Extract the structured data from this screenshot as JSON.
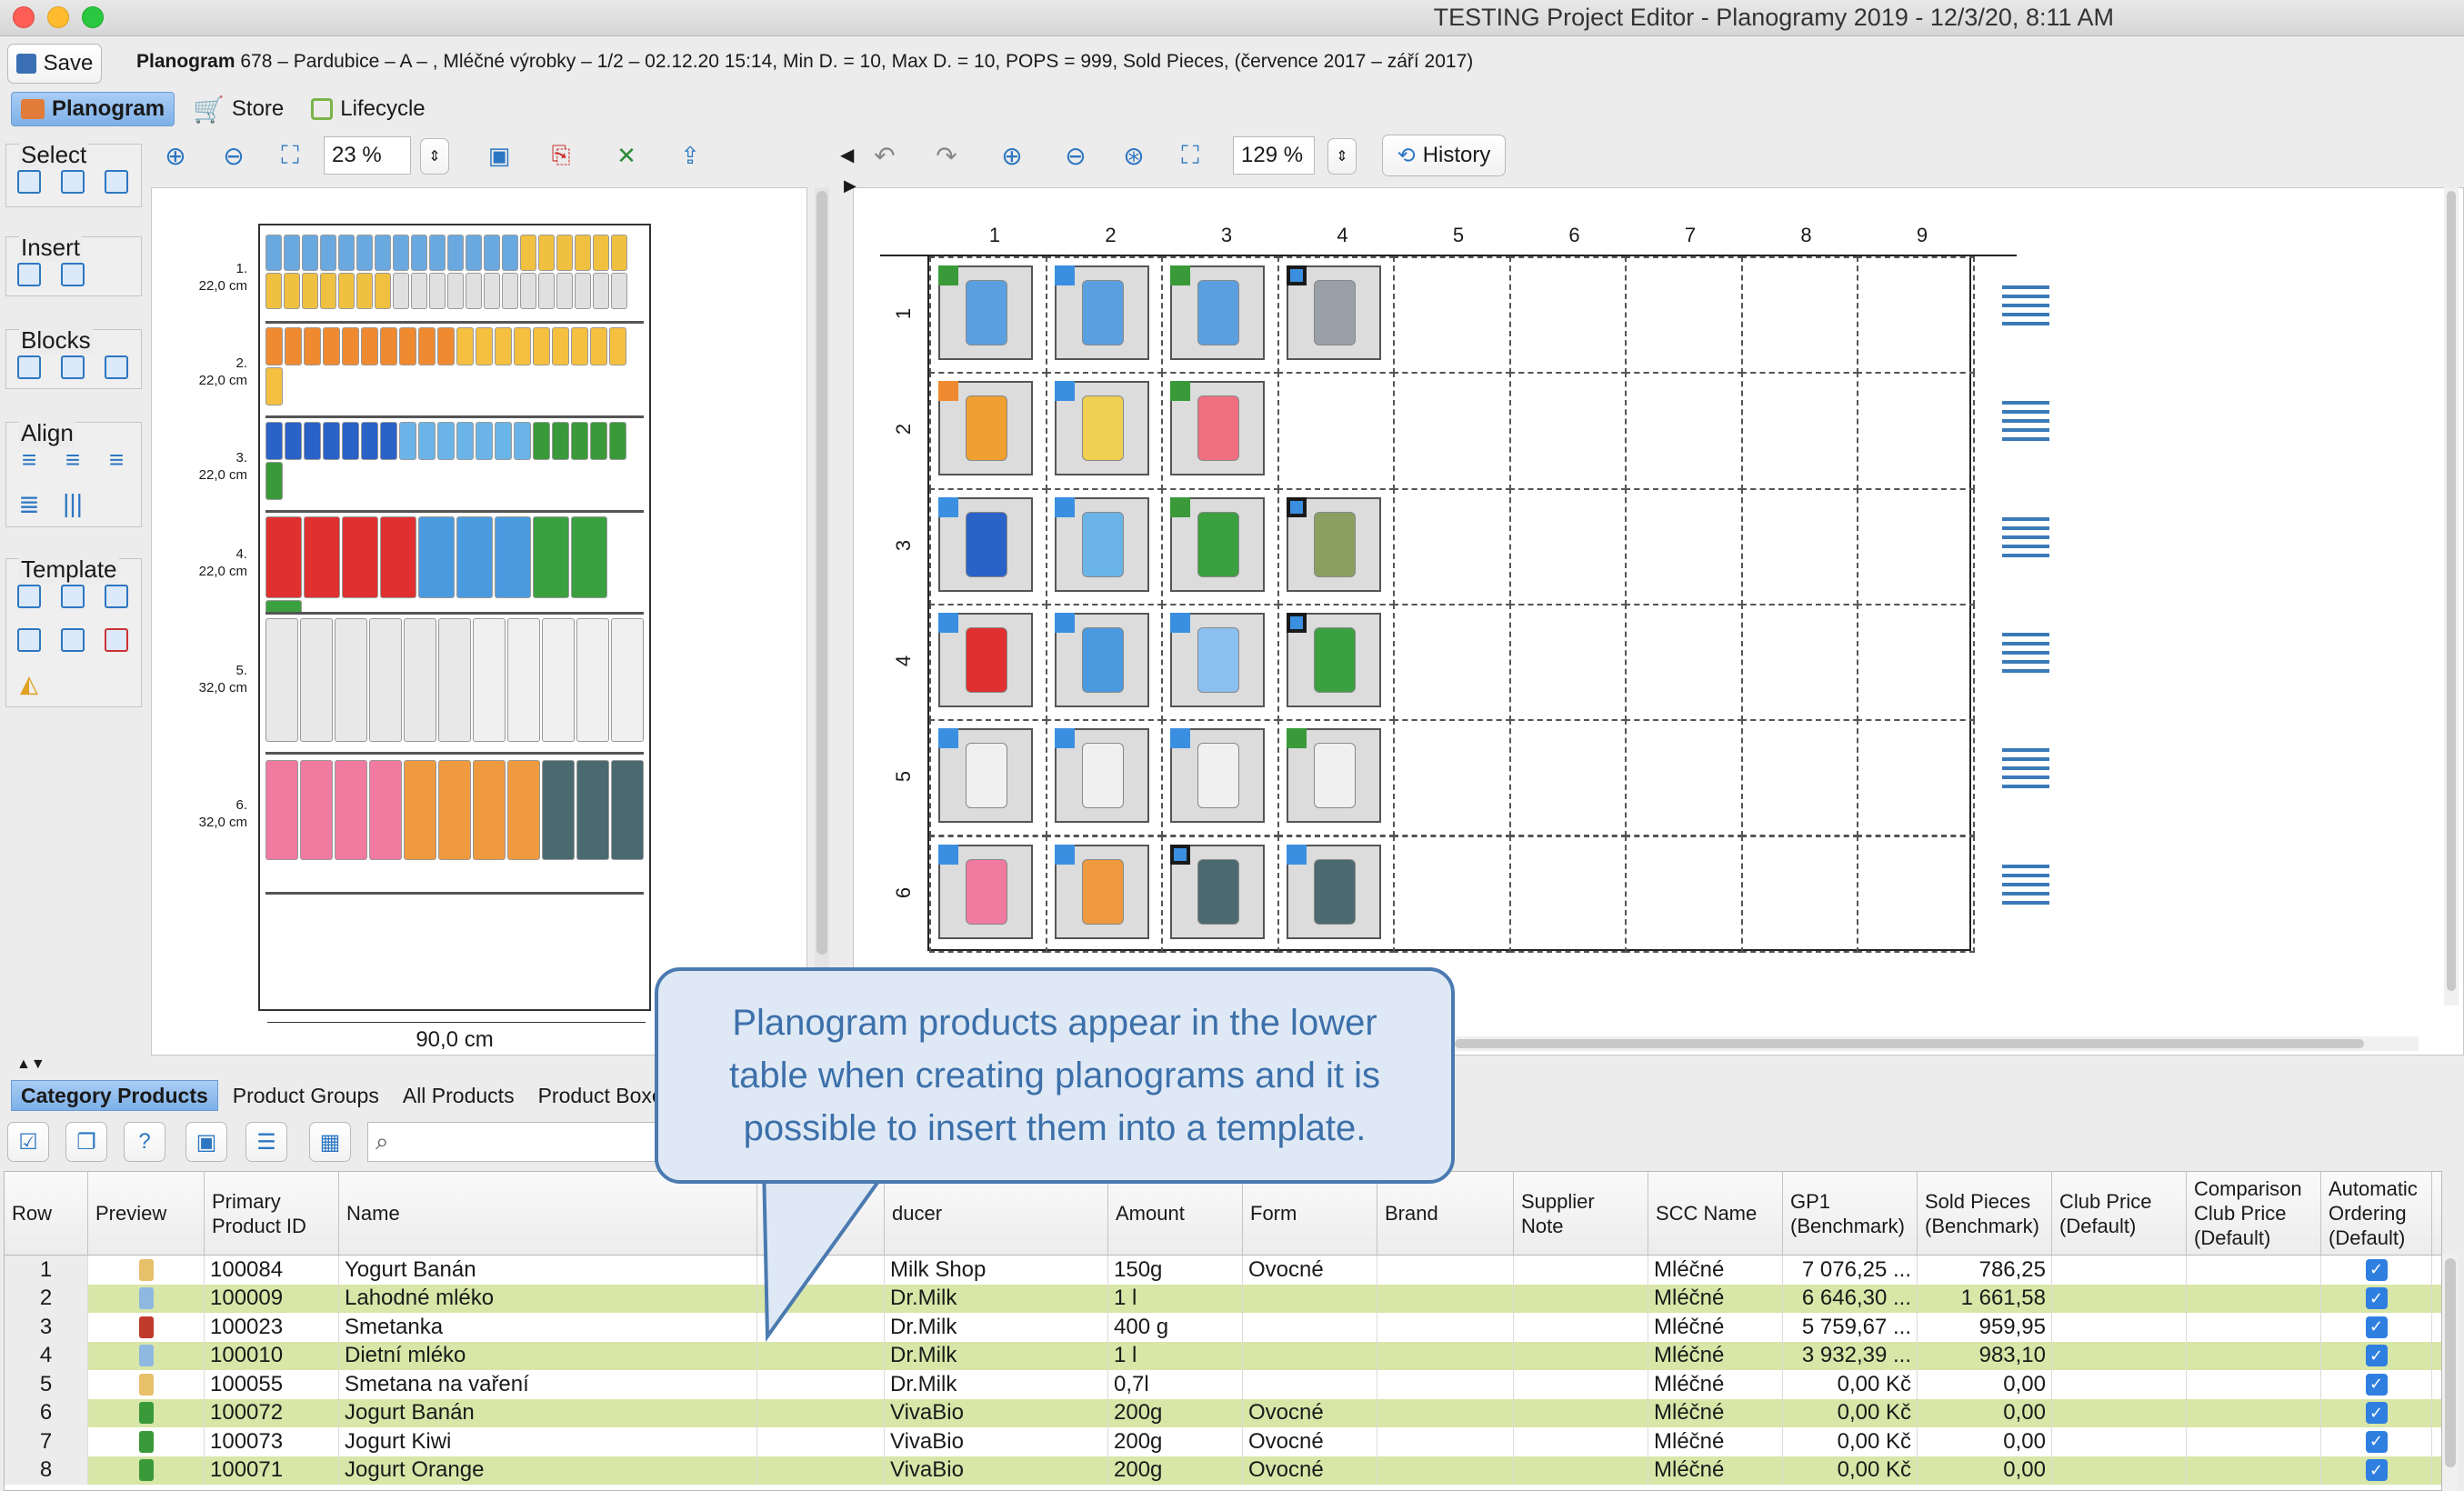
{
  "window": {
    "title": "TESTING Project Editor - Planogramy 2019 - 12/3/20, 8:11 AM"
  },
  "toolbar": {
    "save_label": "Save"
  },
  "planogram_info": {
    "label": "Planogram",
    "details": "678 – Pardubice – A – , Mléčné výrobky – 1/2 – 02.12.20 15:14, Min D. = 10, Max D. = 10, POPS = 999, Sold Pieces, (července 2017 – září 2017)"
  },
  "top_tabs": [
    {
      "label": "Planogram"
    },
    {
      "label": "Store"
    },
    {
      "label": "Lifecycle"
    }
  ],
  "left_groups": {
    "select": "Select",
    "insert": "Insert",
    "blocks": "Blocks",
    "align": "Align",
    "template": "Template"
  },
  "left_zoom": "23 %",
  "right_zoom": "129 %",
  "history_label": "History",
  "shelf_labels": [
    {
      "n": "1.",
      "h": "22,0 cm"
    },
    {
      "n": "2.",
      "h": "22,0 cm"
    },
    {
      "n": "3.",
      "h": "22,0 cm"
    },
    {
      "n": "4.",
      "h": "22,0 cm"
    },
    {
      "n": "5.",
      "h": "32,0 cm"
    },
    {
      "n": "6.",
      "h": "32,0 cm"
    }
  ],
  "shelf_width": "90,0 cm",
  "grid": {
    "cols": [
      "1",
      "2",
      "3",
      "4",
      "5",
      "6",
      "7",
      "8",
      "9"
    ],
    "rows": [
      "1",
      "2",
      "3",
      "4",
      "5",
      "6"
    ]
  },
  "bottom_tabs": [
    {
      "label": "Category Products"
    },
    {
      "label": "Product Groups"
    },
    {
      "label": "All Products"
    },
    {
      "label": "Product Boxe"
    }
  ],
  "search": {
    "placeholder": ""
  },
  "callout": {
    "text": "Planogram products appear in the lower table when creating planograms and it is possible to insert them into a template."
  },
  "table": {
    "headers": [
      "Row",
      "Preview",
      "Primary Product ID",
      "Name",
      "L",
      "ducer",
      "Amount",
      "Form",
      "Brand",
      "Supplier Note",
      "SCC Name",
      "GP1 (Benchmark)",
      "Sold Pieces (Benchmark)",
      "Club Price (Default)",
      "Comparison Club Price (Default)",
      "Automatic Ordering (Default)"
    ],
    "rows": [
      {
        "row": "1",
        "id": "100084",
        "name": "Yogurt Banán",
        "producer": "Milk Shop",
        "amount": "150g",
        "form": "Ovocné",
        "scc": "Mléčné",
        "gp1": "7 076,25 ...",
        "sold": "786,25"
      },
      {
        "row": "2",
        "id": "100009",
        "name": "Lahodné mléko",
        "producer": "Dr.Milk",
        "amount": "1 l",
        "form": "",
        "scc": "Mléčné",
        "gp1": "6 646,30 ...",
        "sold": "1 661,58"
      },
      {
        "row": "3",
        "id": "100023",
        "name": "Smetanka",
        "producer": "Dr.Milk",
        "amount": "400 g",
        "form": "",
        "scc": "Mléčné",
        "gp1": "5 759,67 ...",
        "sold": "959,95"
      },
      {
        "row": "4",
        "id": "100010",
        "name": "Dietní mléko",
        "producer": "Dr.Milk",
        "amount": "1 l",
        "form": "",
        "scc": "Mléčné",
        "gp1": "3 932,39 ...",
        "sold": "983,10"
      },
      {
        "row": "5",
        "id": "100055",
        "name": "Smetana na vaření",
        "producer": "Dr.Milk",
        "amount": "0,7l",
        "form": "",
        "scc": "Mléčné",
        "gp1": "0,00 Kč",
        "sold": "0,00"
      },
      {
        "row": "6",
        "id": "100072",
        "name": "Jogurt Banán",
        "producer": "VivaBio",
        "amount": "200g",
        "form": "Ovocné",
        "scc": "Mléčné",
        "gp1": "0,00 Kč",
        "sold": "0,00"
      },
      {
        "row": "7",
        "id": "100073",
        "name": "Jogurt Kiwi",
        "producer": "VivaBio",
        "amount": "200g",
        "form": "Ovocné",
        "scc": "Mléčné",
        "gp1": "0,00 Kč",
        "sold": "0,00"
      },
      {
        "row": "8",
        "id": "100071",
        "name": "Jogurt Orange",
        "producer": "VivaBio",
        "amount": "200g",
        "form": "Ovocné",
        "scc": "Mléčné",
        "gp1": "0,00 Kč",
        "sold": "0,00"
      }
    ]
  },
  "colors": {
    "accent": "#2f7fe0",
    "highlight_row": "#d8e6a8",
    "callout_border": "#4a7ab0",
    "callout_text": "#3c70aa"
  }
}
